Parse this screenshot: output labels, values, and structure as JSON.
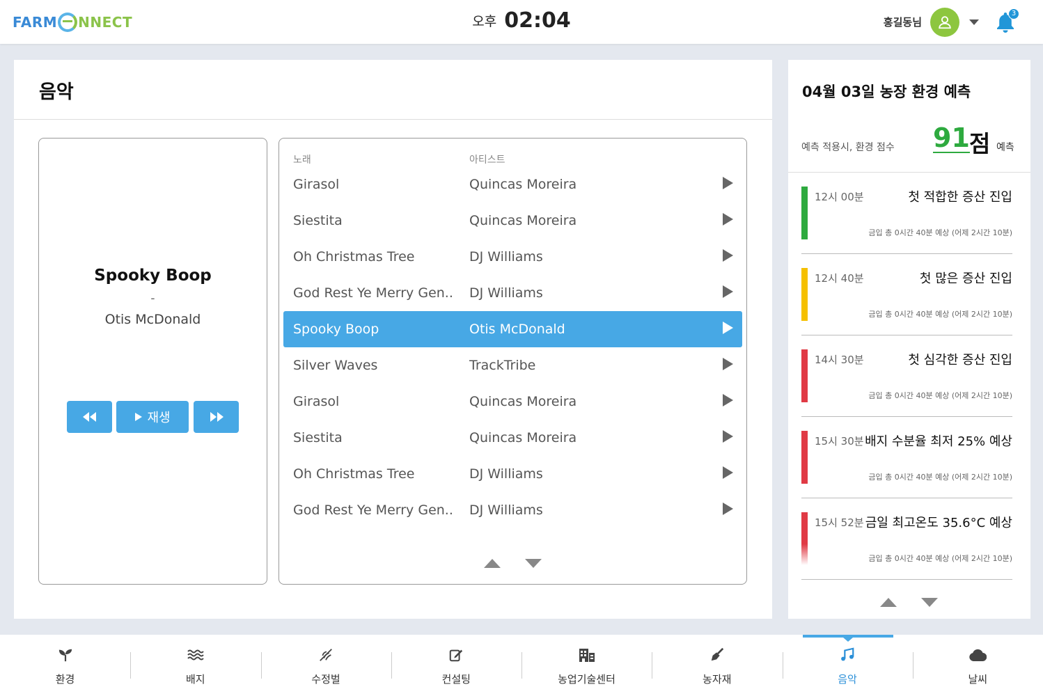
{
  "header": {
    "logo_left": "FARM",
    "logo_right": "NNECT",
    "ampm": "오후",
    "time": "02:04",
    "user_name": "홍길동님",
    "notification_count": "3",
    "accent": "#47a8e5",
    "avatar_color": "#8dc63f"
  },
  "music": {
    "title": "음악",
    "now_playing": {
      "song": "Spooky Boop",
      "separator": "-",
      "artist": "Otis McDonald"
    },
    "controls": {
      "prev_icon": "rewind-icon",
      "play_label": "재생",
      "next_icon": "fast-forward-icon"
    },
    "columns": {
      "song": "노래",
      "artist": "아티스트"
    },
    "tracks": [
      {
        "song": "Girasol",
        "artist": "Quincas Moreira"
      },
      {
        "song": "Siestita",
        "artist": "Quincas Moreira"
      },
      {
        "song": "Oh Christmas Tree",
        "artist": "DJ Williams"
      },
      {
        "song": "God Rest Ye Merry Gen...",
        "artist": "DJ Williams"
      },
      {
        "song": "Spooky Boop",
        "artist": "Otis McDonald"
      },
      {
        "song": "Silver Waves",
        "artist": "TrackTribe"
      },
      {
        "song": "Girasol",
        "artist": "Quincas Moreira"
      },
      {
        "song": "Siestita",
        "artist": "Quincas Moreira"
      },
      {
        "song": "Oh Christmas Tree",
        "artist": "DJ Williams"
      },
      {
        "song": "God Rest Ye Merry Gen...",
        "artist": "DJ Williams"
      }
    ]
  },
  "forecast": {
    "title": "04월 03일 농장 환경 예측",
    "subtitle": "예측 적용시, 환경 점수",
    "score": "91",
    "score_unit": "점",
    "score_suffix": "예측",
    "score_color": "#2eaa3f",
    "alerts": [
      {
        "time": "12시 00분",
        "title": "첫 적합한 증산 진입",
        "desc": "금입 총 0시간 40분 예상 (어제 2시간 10분)",
        "color": "#2eaa3f"
      },
      {
        "time": "12시 40분",
        "title": "첫 많은 증산 진입",
        "desc": "금입 총 0시간 40분 예상 (어제 2시간 10분)",
        "color": "#f5c000"
      },
      {
        "time": "14시 30분",
        "title": "첫 심각한 증산 진입",
        "desc": "금입 총 0시간 40분 예상 (어제 2시간 10분)",
        "color": "#e03a45"
      },
      {
        "time": "15시 30분",
        "title": "배지 수분율 최저 25% 예상",
        "desc": "금입 총 0시간 40분 예상 (어제 2시간 10분)",
        "color": "#e03a45"
      },
      {
        "time": "15시 52분",
        "title": "금일 최고온도 35.6°C 예상",
        "desc": "금입 총 0시간 40분 예상 (어제 2시간 10분)",
        "color": "#e03a45"
      }
    ]
  },
  "nav": {
    "items": [
      {
        "label": "환경",
        "icon": "sprout-icon"
      },
      {
        "label": "배지",
        "icon": "waves-icon"
      },
      {
        "label": "수정벌",
        "icon": "bee-icon"
      },
      {
        "label": "컨설팅",
        "icon": "edit-icon"
      },
      {
        "label": "농업기술센터",
        "icon": "building-icon"
      },
      {
        "label": "농자재",
        "icon": "trowel-icon"
      },
      {
        "label": "음악",
        "icon": "music-icon"
      },
      {
        "label": "날씨",
        "icon": "cloud-icon"
      }
    ],
    "active": "음악"
  }
}
